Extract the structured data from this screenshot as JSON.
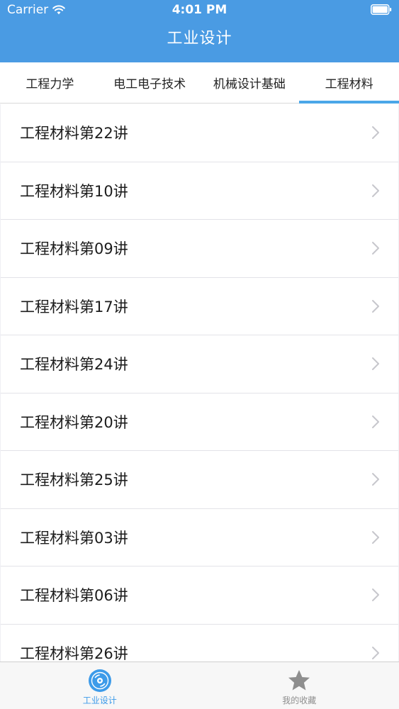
{
  "status_bar": {
    "carrier": "Carrier",
    "time": "4:01 PM"
  },
  "nav": {
    "title": "工业设计"
  },
  "tabs": [
    {
      "label": "工程力学",
      "active": false
    },
    {
      "label": "电工电子技术",
      "active": false
    },
    {
      "label": "机械设计基础",
      "active": false
    },
    {
      "label": "工程材料",
      "active": true
    }
  ],
  "list": {
    "items": [
      {
        "label": "工程材料第22讲"
      },
      {
        "label": "工程材料第10讲"
      },
      {
        "label": "工程材料第09讲"
      },
      {
        "label": "工程材料第17讲"
      },
      {
        "label": "工程材料第24讲"
      },
      {
        "label": "工程材料第20讲"
      },
      {
        "label": "工程材料第25讲"
      },
      {
        "label": "工程材料第03讲"
      },
      {
        "label": "工程材料第06讲"
      },
      {
        "label": "工程材料第26讲"
      }
    ],
    "row_icon": "chevron-right-icon"
  },
  "tabbar": {
    "items": [
      {
        "label": "工业设计",
        "icon": "disc-icon",
        "active": true
      },
      {
        "label": "我的收藏",
        "icon": "star-icon",
        "active": false
      }
    ]
  },
  "colors": {
    "header_bg": "#4a9be3",
    "tab_indicator": "#4aa7e8",
    "tabbar_active": "#3d9be9",
    "tabbar_inactive": "#8e8e8e"
  }
}
